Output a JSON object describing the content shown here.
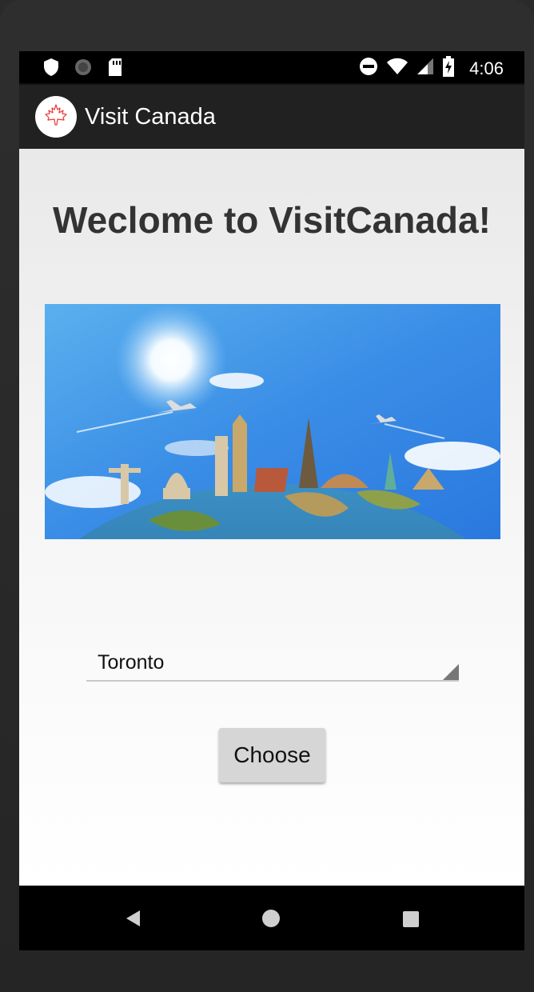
{
  "status_bar": {
    "time": "4:06",
    "icons_left": [
      "shield-icon",
      "sync-icon",
      "sd-card-icon"
    ],
    "icons_right": [
      "do-not-disturb-icon",
      "wifi-icon",
      "signal-icon",
      "battery-charging-icon"
    ]
  },
  "action_bar": {
    "title": "Visit Canada",
    "logo_icon": "maple-leaf-icon",
    "logo_color": "#e53935"
  },
  "main": {
    "heading": "Weclome to VisitCanada!",
    "hero_image": "world-landmarks-globe-image",
    "city_spinner": {
      "selected": "Toronto"
    },
    "choose_button": "Choose"
  },
  "nav_bar": {
    "items": [
      "back-icon",
      "home-icon",
      "recents-icon"
    ]
  },
  "colors": {
    "action_bar_bg": "#212121",
    "status_bar_bg": "#000000",
    "button_bg": "#d6d6d6",
    "heading_color": "#333333"
  }
}
